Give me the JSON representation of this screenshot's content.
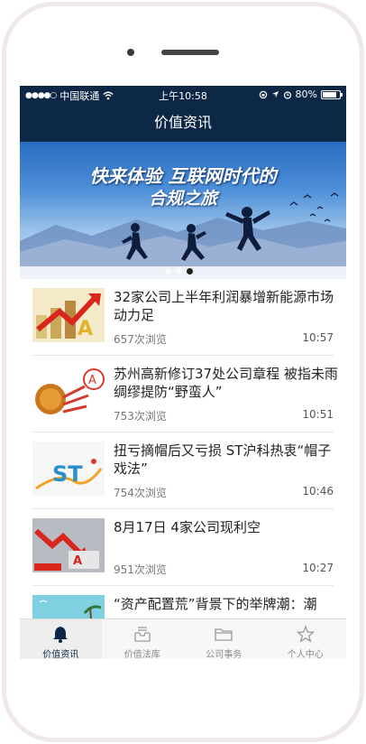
{
  "status_bar": {
    "signal": "●●●●○",
    "carrier": "中国联通",
    "time": "上午10:58",
    "battery_percent": "80%",
    "battery_level": 0.8
  },
  "navbar": {
    "title": "价值资讯"
  },
  "banner": {
    "title_line1": "快来体验 互联网时代的",
    "title_line2": "合规之旅",
    "page_count": 3,
    "active_page": 3
  },
  "news": [
    {
      "title": "32家公司上半年利润暴增新能源市场动力足",
      "views": "657次浏览",
      "time": "10:57",
      "thumb_icon": "arrow-chart-icon"
    },
    {
      "title": "苏州高新修订37处公司章程 被指未雨绸缪提防“野蛮人”",
      "views": "753次浏览",
      "time": "10:51",
      "thumb_icon": "a-share-coin-icon"
    },
    {
      "title": "扭亏摘帽后又亏损 ST沪科热衷“帽子戏法”",
      "views": "754次浏览",
      "time": "10:46",
      "thumb_icon": "st-label-icon"
    },
    {
      "title": "8月17日 4家公司现利空",
      "views": "951次浏览",
      "time": "10:27",
      "thumb_icon": "falling-arrow-icon"
    },
    {
      "title": "“资产配置荒”背景下的举牌潮：潮",
      "views": "",
      "time": "",
      "thumb_icon": "beach-scene-icon"
    }
  ],
  "tabs": [
    {
      "label": "价值资讯",
      "icon": "bell-icon",
      "active": true
    },
    {
      "label": "价值法库",
      "icon": "inbox-icon",
      "active": false
    },
    {
      "label": "公司事务",
      "icon": "folder-icon",
      "active": false
    },
    {
      "label": "个人中心",
      "icon": "star-icon",
      "active": false
    }
  ],
  "colors": {
    "nav_bg": "#0d2847",
    "frame": "#efe7ea",
    "tab_active": "#0d2847"
  }
}
